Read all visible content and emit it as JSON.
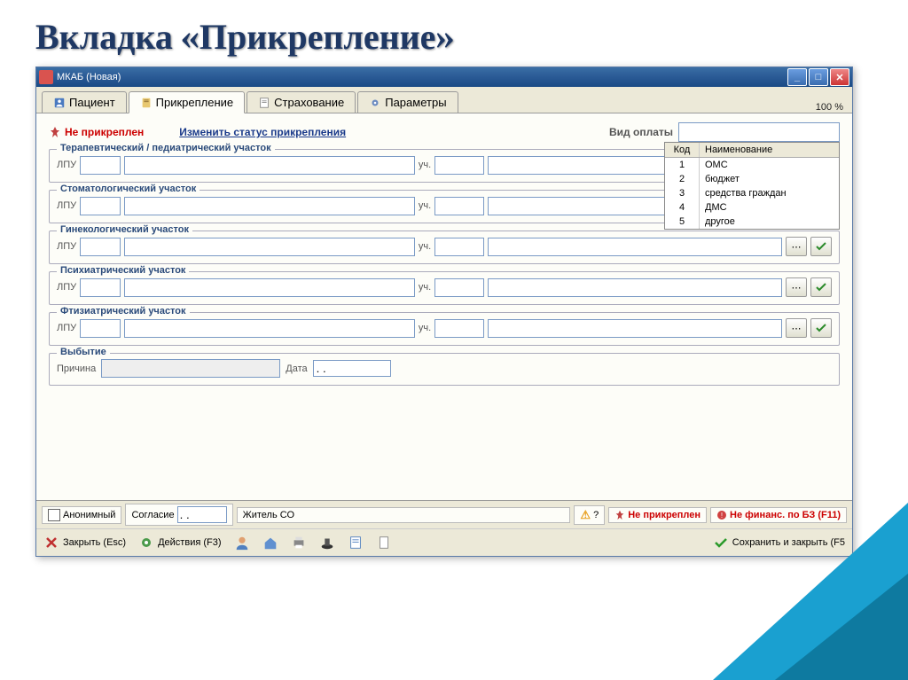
{
  "slide_title": "Вкладка «Прикрепление»",
  "window": {
    "title": "МКАБ (Новая)"
  },
  "tabs": [
    {
      "label": "Пациент"
    },
    {
      "label": "Прикрепление"
    },
    {
      "label": "Страхование"
    },
    {
      "label": "Параметры"
    }
  ],
  "zoom": "100 %",
  "status": {
    "not_attached": "Не прикреплен",
    "change_link": "Изменить статус прикрепления",
    "payment_label": "Вид оплаты"
  },
  "dropdown": {
    "col_code": "Код",
    "col_name": "Наименование",
    "rows": [
      {
        "code": "1",
        "name": "ОМС"
      },
      {
        "code": "2",
        "name": "бюджет"
      },
      {
        "code": "3",
        "name": "средства граждан"
      },
      {
        "code": "4",
        "name": "ДМС"
      },
      {
        "code": "5",
        "name": "другое"
      }
    ]
  },
  "labels": {
    "lpu": "ЛПУ",
    "uch": "уч."
  },
  "sections": [
    {
      "title": "Терапевтический / педиатрический участок"
    },
    {
      "title": "Стоматологический участок"
    },
    {
      "title": "Гинекологический участок"
    },
    {
      "title": "Психиатрический участок"
    },
    {
      "title": "Фтизиатрический участок"
    }
  ],
  "departure": {
    "title": "Выбытие",
    "reason_label": "Причина",
    "date_label": "Дата",
    "date_value": ". ."
  },
  "bottom": {
    "anonymous": "Анонимный",
    "consent": "Согласие",
    "consent_value": ". .",
    "resident": "Житель СО",
    "question": "?",
    "not_attached": "Не прикреплен",
    "not_financed": "Не финанс. по БЗ (F11)"
  },
  "toolbar": {
    "close": "Закрыть (Esc)",
    "actions": "Действия (F3)",
    "save": "Сохранить и закрыть (F5"
  }
}
